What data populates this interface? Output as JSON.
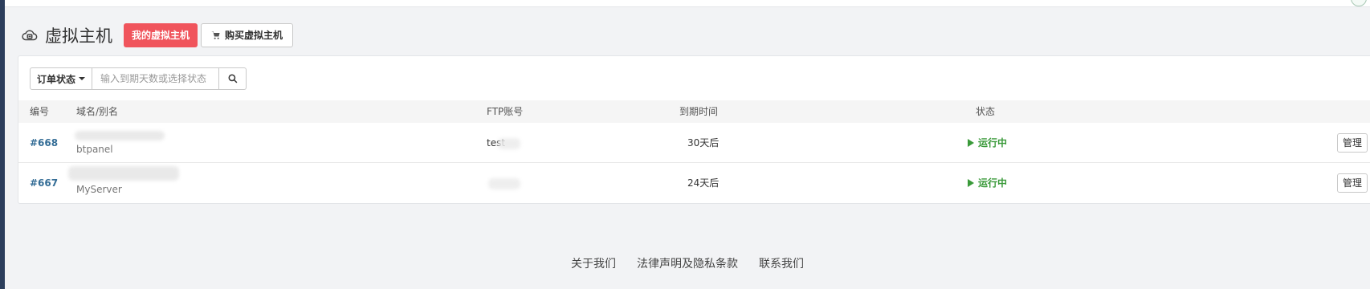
{
  "header": {
    "icon": "cloud-server-icon",
    "title": "虚拟主机",
    "tab_my_hosts": "我的虚拟主机",
    "tab_buy_host": "购买虚拟主机",
    "buy_icon": "cart-icon",
    "primary_color": "#f0545c"
  },
  "search": {
    "status_label": "订单状态",
    "placeholder": "输入到期天数或选择状态",
    "value": "",
    "search_icon": "search-icon"
  },
  "table": {
    "columns": [
      "编号",
      "域名/别名",
      "FTP账号",
      "到期时间",
      "状态"
    ],
    "rows": [
      {
        "id": "#668",
        "alias": "btpanel",
        "ftp_account": "test",
        "expiry": "30天后",
        "status": "运行中",
        "action": "管理"
      },
      {
        "id": "#667",
        "alias": "MyServer",
        "ftp_account": "",
        "expiry": "24天后",
        "status": "运行中",
        "action": "管理"
      }
    ],
    "status_color": "#3a9a3a",
    "id_color": "#346d96"
  },
  "footer": {
    "links": [
      "关于我们",
      "法律声明及隐私条款",
      "联系我们"
    ]
  }
}
